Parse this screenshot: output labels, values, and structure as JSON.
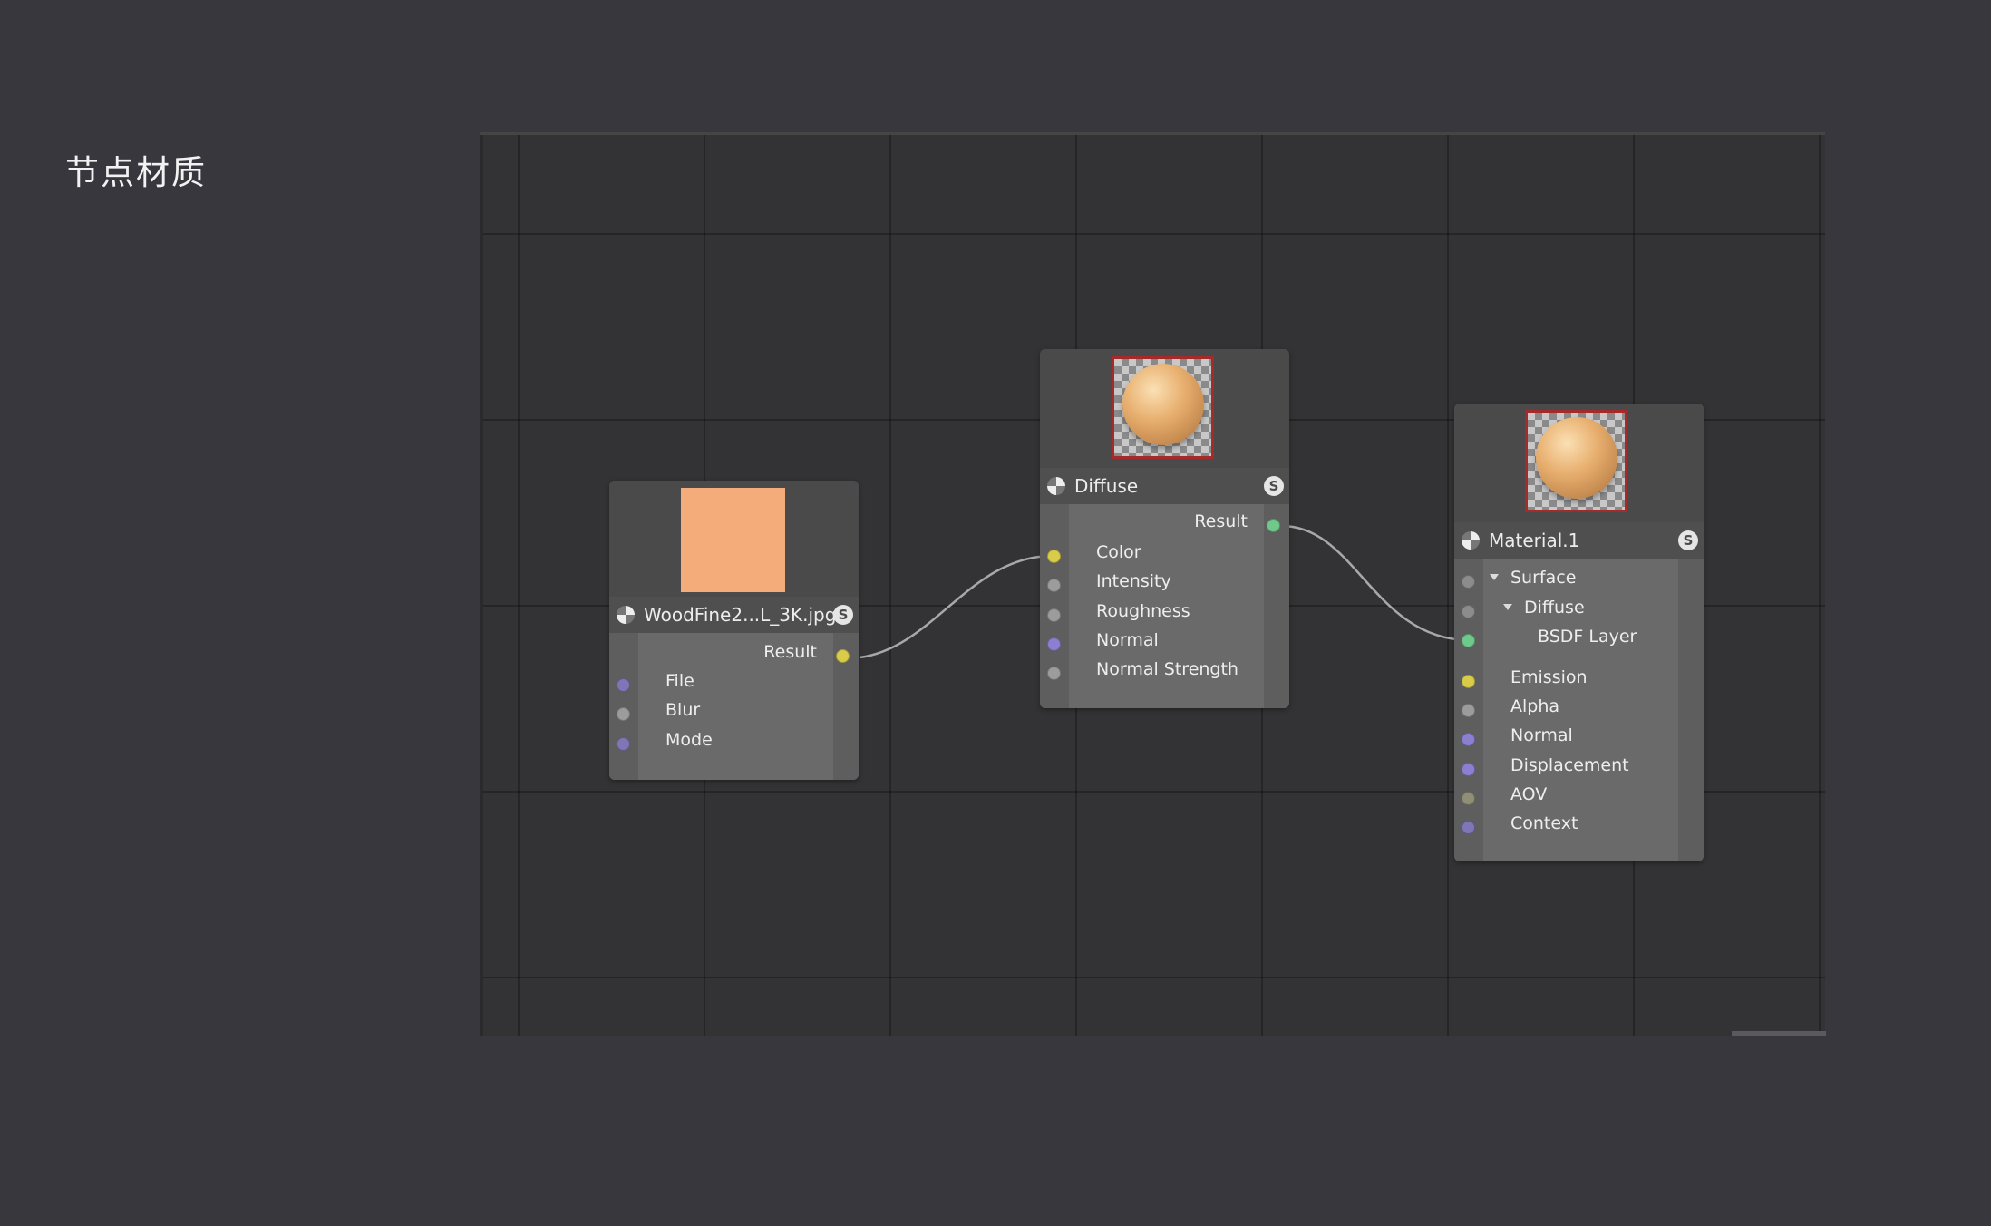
{
  "page": {
    "title": "节点材质"
  },
  "colors": {
    "port_yellow": "#d8cc4a",
    "port_gray": "#9c9c9c",
    "port_purple": "#8b7fd0",
    "port_green": "#6fc98a",
    "port_olive": "#8f8f78"
  },
  "nodes": {
    "texture": {
      "title": "WoodFine2...L_3K.jpg",
      "badge": "S",
      "output": "Result",
      "inputs": [
        "File",
        "Blur",
        "Mode"
      ]
    },
    "diffuse": {
      "title": "Diffuse",
      "badge": "S",
      "output": "Result",
      "inputs": [
        "Color",
        "Intensity",
        "Roughness",
        "Normal",
        "Normal Strength"
      ]
    },
    "material": {
      "title": "Material.1",
      "badge": "S",
      "surface": "Surface",
      "diffuse": "Diffuse",
      "bsdf": "BSDF Layer",
      "inputs": [
        "Emission",
        "Alpha",
        "Normal",
        "Displacement",
        "AOV",
        "Context"
      ]
    }
  }
}
